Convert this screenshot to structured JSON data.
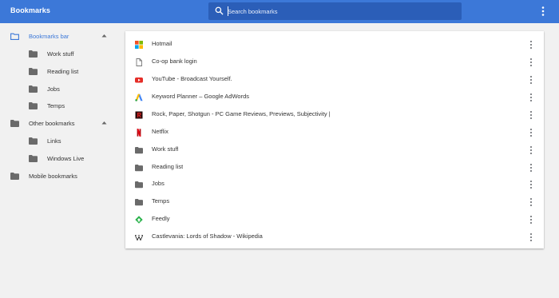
{
  "app": {
    "title": "Bookmarks"
  },
  "search": {
    "placeholder": "Search bookmarks",
    "value": ""
  },
  "colors": {
    "toolbar": "#3c78d8",
    "search_bg": "#2b5eb8",
    "accent": "#3c78d8",
    "background": "#f1f1f1",
    "folder": "#6a6a6a"
  },
  "sidebar": {
    "items": [
      {
        "label": "Bookmarks bar",
        "icon": "folder-outline-icon",
        "selected": true,
        "expanded": true
      },
      {
        "label": "Work stuff",
        "icon": "folder-icon"
      },
      {
        "label": "Reading list",
        "icon": "folder-icon"
      },
      {
        "label": "Jobs",
        "icon": "folder-icon"
      },
      {
        "label": "Temps",
        "icon": "folder-icon"
      },
      {
        "label": "Other bookmarks",
        "icon": "folder-icon",
        "expanded": true
      },
      {
        "label": "Links",
        "icon": "folder-icon"
      },
      {
        "label": "Windows Live",
        "icon": "folder-icon"
      },
      {
        "label": "Mobile bookmarks",
        "icon": "folder-icon"
      }
    ]
  },
  "list": {
    "items": [
      {
        "label": "Hotmail",
        "icon": "windows-logo-icon"
      },
      {
        "label": "Co-op bank login",
        "icon": "page-icon"
      },
      {
        "label": "YouTube - Broadcast Yourself.",
        "icon": "youtube-icon"
      },
      {
        "label": "Keyword Planner – Google AdWords",
        "icon": "adwords-icon"
      },
      {
        "label": "Rock, Paper, Shotgun - PC Game Reviews, Previews, Subjectivity |",
        "icon": "rps-icon"
      },
      {
        "label": "Netflix",
        "icon": "netflix-icon"
      },
      {
        "label": "Work stuff",
        "icon": "folder-icon"
      },
      {
        "label": "Reading list",
        "icon": "folder-icon"
      },
      {
        "label": "Jobs",
        "icon": "folder-icon"
      },
      {
        "label": "Temps",
        "icon": "folder-icon"
      },
      {
        "label": "Feedly",
        "icon": "feedly-icon"
      },
      {
        "label": "Castlevania: Lords of Shadow - Wikipedia",
        "icon": "wikipedia-icon"
      }
    ]
  }
}
